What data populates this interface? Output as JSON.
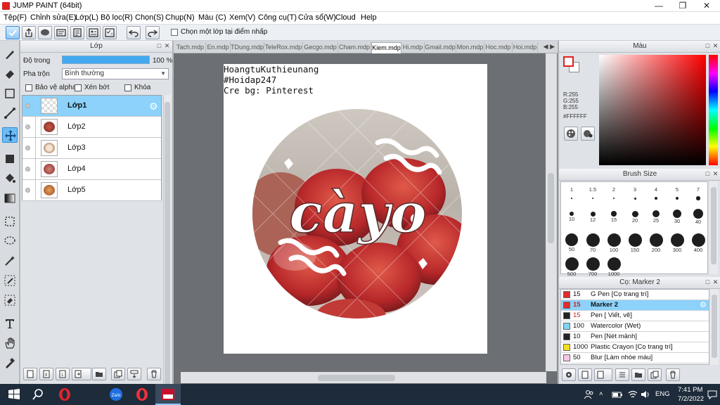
{
  "window": {
    "title": "JUMP PAINT (64bit)"
  },
  "menu": [
    "Tệp(F)",
    "Chỉnh sửa(E)",
    "Lớp(L)",
    "Bộ lọc(R)",
    "Chọn(S)",
    "Chụp(N)",
    "Màu (C)",
    "Xem(V)",
    "Công cụ(T)",
    "Cửa sổ(W)",
    "Cloud",
    "Help"
  ],
  "toolbar": {
    "reference_label": "Chọn một lớp tại điểm nhấp"
  },
  "layer_panel": {
    "title": "Lớp",
    "opacity_label": "Độ trong",
    "opacity_value": "100 %",
    "opacity": 1.0,
    "blend_label": "Pha trộn",
    "blend_value": "Bình thường",
    "protect_alpha": "Bảo vệ alpha",
    "clipping": "Xén bớt",
    "lock": "Khóa",
    "layers": [
      {
        "name": "Lớp1",
        "selected": true,
        "thumb": "transparent"
      },
      {
        "name": "Lớp2",
        "selected": false,
        "thumb": "#a33a2c"
      },
      {
        "name": "Lớp3",
        "selected": false,
        "thumb": "#8a5a3c"
      },
      {
        "name": "Lớp4",
        "selected": false,
        "thumb": "#9e3a36"
      },
      {
        "name": "Lớp5",
        "selected": false,
        "thumb": "#b8703c"
      }
    ]
  },
  "canvas": {
    "tabs": [
      "Tach.mdp",
      "En.mdp",
      "TDung.mdp",
      "TeleRox.mdp",
      "Gecgo.mdp",
      "Cham.mdp",
      "Kiem.mdp",
      "Hi.mdp",
      "Gmail.mdp",
      "Mon.mdp",
      "Hoc.mdp",
      "Hoi.mdp"
    ],
    "active_tab": "Kiem.mdp",
    "text_lines": [
      "HoangtuKuthieunang",
      "#Hoidap247",
      "Cre bg: Pinterest"
    ],
    "artwork_text": "càyo"
  },
  "color_panel": {
    "title": "Màu",
    "r": "R:255",
    "g": "G:255",
    "b": "B:255",
    "hex": "#FFFFFF",
    "fg_color": "#ffffff",
    "accent": "#e02020"
  },
  "brush_panel": {
    "title": "Brush Size",
    "sizes": [
      "1",
      "1.5",
      "2",
      "3",
      "4",
      "5",
      "7",
      "10",
      "12",
      "15",
      "20",
      "25",
      "30",
      "40",
      "50",
      "70",
      "100",
      "150",
      "200",
      "300",
      "400",
      "500",
      "700",
      "1000"
    ]
  },
  "tool_panel": {
    "title": "Cọ: Marker 2",
    "tools": [
      {
        "size": "15",
        "name": "G Pen [Cọ trang trí]",
        "color": "#e02c2c",
        "selected": false
      },
      {
        "size": "15",
        "name": "Marker 2",
        "color": "#e02c2c",
        "selected": true
      },
      {
        "size": "15",
        "name": "Pen [ Viết, vẽ]",
        "color": "#222222",
        "selected": false
      },
      {
        "size": "100",
        "name": "Watercolor (Wet)",
        "color": "#7fd3f5",
        "selected": false
      },
      {
        "size": "10",
        "name": "Pen [Nét mảnh]",
        "color": "#222222",
        "selected": false
      },
      {
        "size": "1000",
        "name": "Plastic Crayon [Cọ trang trí]",
        "color": "#f5dc22",
        "selected": false
      },
      {
        "size": "50",
        "name": "Blur [Làm nhòe màu]",
        "color": "#f7c6e6",
        "selected": false
      }
    ]
  },
  "taskbar": {
    "language": "ENG",
    "time": "7:41 PM",
    "date": "7/2/2022"
  }
}
